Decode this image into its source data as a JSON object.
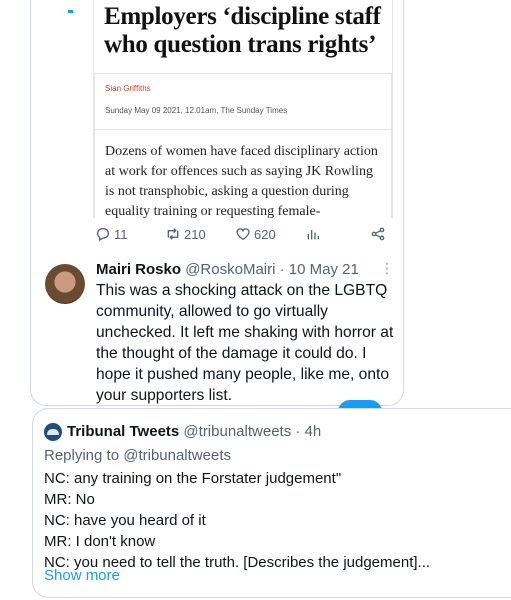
{
  "quoted_article": {
    "headline": "Employers ‘discipline staff who question trans rights’",
    "byline": "Sian Griffiths",
    "dateline": "Sunday May 09 2021, 12.01am, The Sunday Times",
    "body": "Dozens of women have faced disciplinary action at work for offences such as saying JK Rowling is not transphobic, asking a question during equality training or requesting female-"
  },
  "actions": {
    "replies": "11",
    "retweets": "210",
    "likes": "620"
  },
  "reply": {
    "name": "Mairi Rosko",
    "handle": "@RoskoMairi",
    "separator": "·",
    "date": "10 May 21",
    "text": "This was a shocking attack on the LGBTQ community, allowed to go virtually unchecked. It left me shaking with horror at the thought of the damage it could do. I hope it pushed many people, like me, onto your supporters list."
  },
  "tribunal_tweet": {
    "name": "Tribunal Tweets",
    "handle": "@tribunaltweets",
    "separator": "·",
    "time": "4h",
    "replying_prefix": "Replying to",
    "replying_to": "@tribunaltweets",
    "lines": [
      "NC: any training on the Forstater judgement\"",
      "MR: No",
      "NC: have you heard of it",
      "MR: I don't know",
      "NC: you need to tell the truth. [Describes the judgement]..."
    ],
    "show_more": "Show more"
  },
  "icons": {
    "reply": "reply-icon",
    "retweet": "retweet-icon",
    "like": "heart-icon",
    "views": "views-icon",
    "share": "share-icon",
    "more": "more-icon"
  },
  "colors": {
    "accent": "#1d9bf0",
    "muted": "#536471",
    "border": "#cfd9de"
  }
}
